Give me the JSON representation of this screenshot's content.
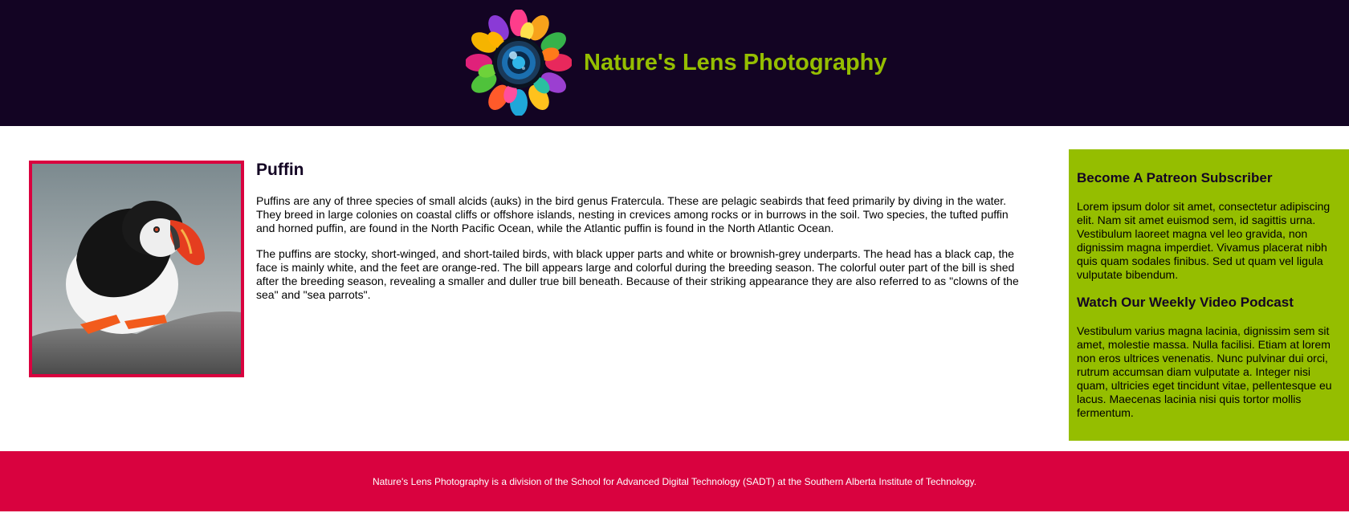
{
  "header": {
    "title": "Nature's Lens Photography",
    "logo_icon": "camera-lens-floral-logo-icon",
    "background_color": "#130423",
    "title_color": "#95be00"
  },
  "main": {
    "image_icon": "puffin-photo",
    "image_border_color": "#d9023f",
    "heading": "Puffin",
    "paragraphs": [
      "Puffins are any of three species of small alcids (auks) in the bird genus Fratercula. These are pelagic seabirds that feed primarily by diving in the water. They breed in large colonies on coastal cliffs or offshore islands, nesting in crevices among rocks or in burrows in the soil. Two species, the tufted puffin and horned puffin, are found in the North Pacific Ocean, while the Atlantic puffin is found in the North Atlantic Ocean.",
      "The puffins are stocky, short-winged, and short-tailed birds, with black upper parts and white or brownish-grey underparts. The head has a black cap, the face is mainly white, and the feet are orange-red. The bill appears large and colorful during the breeding season. The colorful outer part of the bill is shed after the breeding season, revealing a smaller and duller true bill beneath. Because of their striking appearance they are also referred to as \"clowns of the sea\" and \"sea parrots\"."
    ]
  },
  "aside": {
    "background_color": "#95be00",
    "sections": [
      {
        "heading": "Become A Patreon Subscriber",
        "text": "Lorem ipsum dolor sit amet, consectetur adipiscing elit. Nam sit amet euismod sem, id sagittis urna. Vestibulum laoreet magna vel leo gravida, non dignissim magna imperdiet. Vivamus placerat nibh quis quam sodales finibus. Sed ut quam vel ligula vulputate bibendum."
      },
      {
        "heading": "Watch Our Weekly Video Podcast",
        "text": "Vestibulum varius magna lacinia, dignissim sem sit amet, molestie massa. Nulla facilisi. Etiam at lorem non eros ultrices venenatis. Nunc pulvinar dui orci, rutrum accumsan diam vulputate a. Integer nisi quam, ultricies eget tincidunt vitae, pellentesque eu lacus. Maecenas lacinia nisi quis tortor mollis fermentum."
      }
    ]
  },
  "footer": {
    "text": "Nature's Lens Photography is a division of the School for Advanced Digital Technology (SADT) at the Southern Alberta Institute of Technology.",
    "background_color": "#d9023f"
  }
}
